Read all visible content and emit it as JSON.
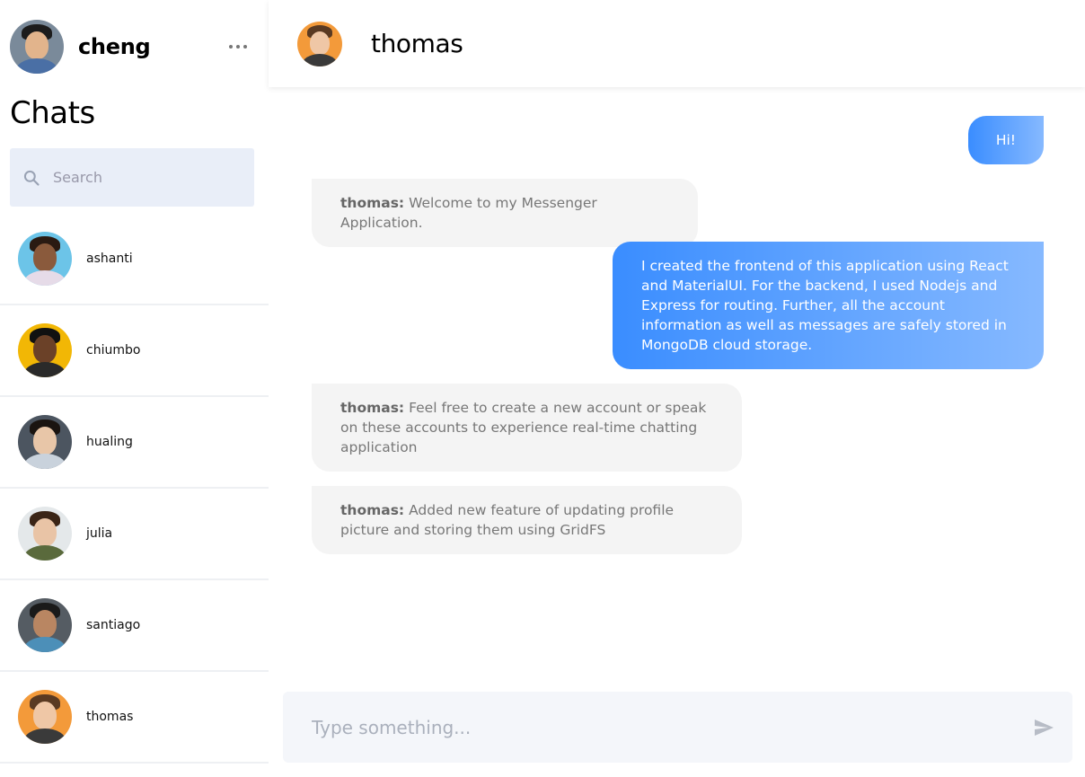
{
  "me": {
    "name": "cheng"
  },
  "sidebar": {
    "title": "Chats",
    "search_placeholder": "Search",
    "contacts": [
      {
        "name": "ashanti"
      },
      {
        "name": "chiumbo"
      },
      {
        "name": "hualing"
      },
      {
        "name": "julia"
      },
      {
        "name": "santiago"
      },
      {
        "name": "thomas"
      }
    ]
  },
  "chat": {
    "title": "thomas",
    "messages": [
      {
        "direction": "outgoing",
        "text": "Hi!"
      },
      {
        "direction": "incoming",
        "sender": "thomas:",
        "text": "Welcome to my Messenger Application."
      },
      {
        "direction": "outgoing",
        "text": "I created the frontend of this application using React and MaterialUI. For the backend, I used Nodejs and Express for routing. Further, all the account information as well as messages are safely stored in MongoDB cloud storage."
      },
      {
        "direction": "incoming",
        "sender": "thomas:",
        "text": "Feel free to create a new account or speak on these accounts to experience real-time chatting application"
      },
      {
        "direction": "incoming",
        "sender": "thomas:",
        "text": "Added new feature of updating profile picture and storing them using GridFS"
      }
    ],
    "composer_placeholder": "Type something..."
  },
  "colors": {
    "accent_start": "#3a8dff",
    "accent_end": "#86b9ff",
    "incoming_bg": "#f4f4f4",
    "search_bg": "#e9eef8"
  },
  "icons": {
    "more": "more-horizontal-icon",
    "search": "search-icon",
    "send": "send-icon"
  }
}
